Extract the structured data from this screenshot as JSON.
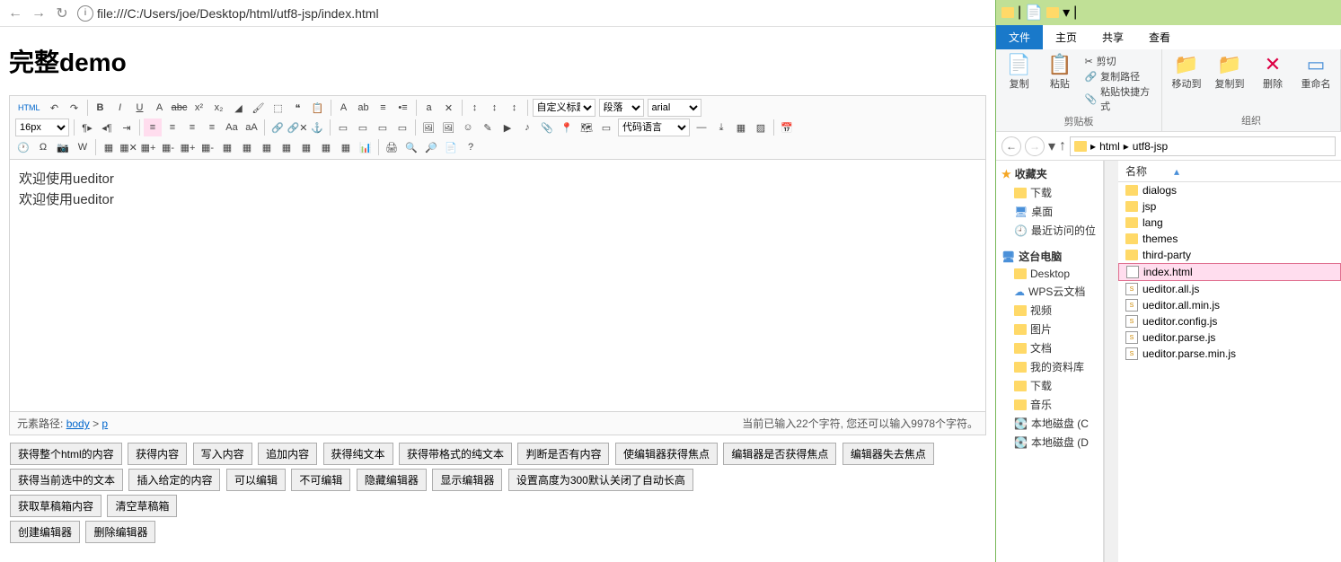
{
  "nav": {
    "url": "file:///C:/Users/joe/Desktop/html/utf8-jsp/index.html"
  },
  "page": {
    "title": "完整demo",
    "toolbar": {
      "html": "HTML",
      "heading": "自定义标题",
      "para": "段落",
      "font": "arial",
      "size": "16px",
      "codelang": "代码语言"
    },
    "content_1": "欢迎使用ueditor",
    "content_2": "欢迎使用ueditor",
    "status_path_label": "元素路径:",
    "status_body": "body",
    "status_gt": ">",
    "status_p": "p",
    "status_count": "当前已输入22个字符, 您还可以输入9978个字符。",
    "btns": [
      "获得整个html的内容",
      "获得内容",
      "写入内容",
      "追加内容",
      "获得纯文本",
      "获得带格式的纯文本",
      "判断是否有内容",
      "使编辑器获得焦点",
      "编辑器是否获得焦点",
      "编辑器失去焦点",
      "获得当前选中的文本",
      "插入给定的内容",
      "可以编辑",
      "不可编辑",
      "隐藏编辑器",
      "显示编辑器",
      "设置高度为300默认关闭了自动长高",
      "获取草稿箱内容",
      "清空草稿箱",
      "创建编辑器",
      "删除编辑器"
    ]
  },
  "explorer": {
    "tabs": [
      "文件",
      "主页",
      "共享",
      "查看"
    ],
    "ribbon": {
      "copy": "复制",
      "paste": "粘贴",
      "cut": "剪切",
      "copypath": "复制路径",
      "pasteShortcut": "粘贴快捷方式",
      "clipboard": "剪贴板",
      "moveto": "移动到",
      "copyto": "复制到",
      "delete": "删除",
      "rename": "重命名",
      "organize": "组织"
    },
    "breadcrumb": [
      "html",
      "utf8-jsp"
    ],
    "tree": {
      "fav": "收藏夹",
      "downloads": "下载",
      "desktop": "桌面",
      "recent": "最近访问的位",
      "pc": "这台电脑",
      "Desktop": "Desktop",
      "wps": "WPS云文档",
      "video": "视频",
      "pic": "图片",
      "doc": "文档",
      "mydata": "我的资料库",
      "dl": "下载",
      "music": "音乐",
      "diskC": "本地磁盘 (C",
      "diskD": "本地磁盘 (D"
    },
    "files": {
      "nameCol": "名称",
      "items": [
        "dialogs",
        "jsp",
        "lang",
        "themes",
        "third-party",
        "index.html",
        "ueditor.all.js",
        "ueditor.all.min.js",
        "ueditor.config.js",
        "ueditor.parse.js",
        "ueditor.parse.min.js"
      ]
    }
  }
}
